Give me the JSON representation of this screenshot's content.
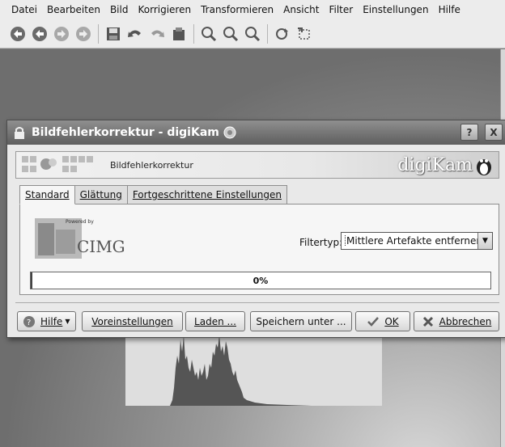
{
  "menubar": {
    "items": [
      "Datei",
      "Bearbeiten",
      "Bild",
      "Korrigieren",
      "Transformieren",
      "Ansicht",
      "Filter",
      "Einstellungen",
      "Hilfe"
    ]
  },
  "toolbar": {
    "icons": [
      "nav-first-icon",
      "nav-back-icon",
      "nav-forward-icon",
      "nav-last-icon",
      "save-icon",
      "undo-icon",
      "redo-icon",
      "revert-icon",
      "zoom-in-icon",
      "zoom-out-icon",
      "zoom-fit-icon",
      "rotate-icon",
      "crop-icon"
    ]
  },
  "dialog": {
    "title": "Bildfehlerkorrektur - digiKam",
    "help_button": "?",
    "close_button": "X",
    "banner": {
      "label": "Bildfehlerkorrektur",
      "logo": "digiKam"
    },
    "tabs": [
      {
        "label": "Standard",
        "active": true
      },
      {
        "label": "Glättung",
        "active": false
      },
      {
        "label": "Fortgeschrittene Einstellungen",
        "active": false
      }
    ],
    "panel": {
      "logo_small": "Powered by",
      "logo_big": "CIMG",
      "filter_label": "Filtertyp:",
      "filter_value": "Mittlere Artefakte entfernen",
      "progress_text": "0%",
      "progress_value": 0
    },
    "buttons": {
      "help": "Hilfe",
      "defaults": "Voreinstellungen",
      "load": "Laden ...",
      "save_as": "Speichern unter ...",
      "ok": "OK",
      "cancel": "Abbrechen"
    }
  },
  "colors": {
    "title_bar": "#6b6b6b",
    "dialog_bg": "#e9e9e9",
    "workspace": "#7b7b7b"
  }
}
